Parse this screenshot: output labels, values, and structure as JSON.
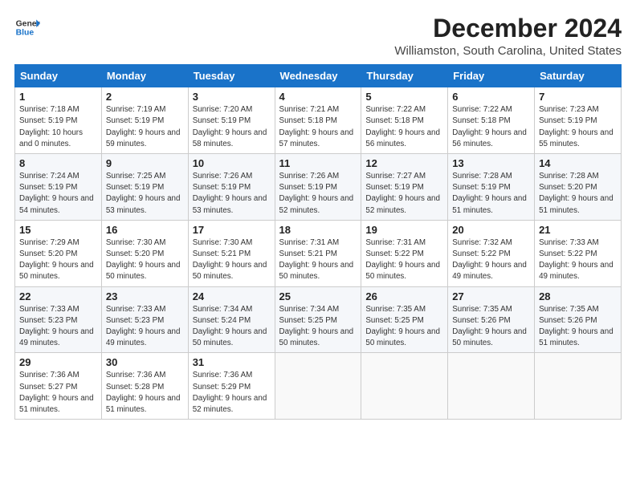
{
  "logo": {
    "line1": "General",
    "line2": "Blue"
  },
  "title": "December 2024",
  "location": "Williamston, South Carolina, United States",
  "weekdays": [
    "Sunday",
    "Monday",
    "Tuesday",
    "Wednesday",
    "Thursday",
    "Friday",
    "Saturday"
  ],
  "weeks": [
    [
      {
        "day": "1",
        "sunrise": "7:18 AM",
        "sunset": "5:19 PM",
        "daylight": "10 hours and 0 minutes."
      },
      {
        "day": "2",
        "sunrise": "7:19 AM",
        "sunset": "5:19 PM",
        "daylight": "9 hours and 59 minutes."
      },
      {
        "day": "3",
        "sunrise": "7:20 AM",
        "sunset": "5:19 PM",
        "daylight": "9 hours and 58 minutes."
      },
      {
        "day": "4",
        "sunrise": "7:21 AM",
        "sunset": "5:18 PM",
        "daylight": "9 hours and 57 minutes."
      },
      {
        "day": "5",
        "sunrise": "7:22 AM",
        "sunset": "5:18 PM",
        "daylight": "9 hours and 56 minutes."
      },
      {
        "day": "6",
        "sunrise": "7:22 AM",
        "sunset": "5:18 PM",
        "daylight": "9 hours and 56 minutes."
      },
      {
        "day": "7",
        "sunrise": "7:23 AM",
        "sunset": "5:19 PM",
        "daylight": "9 hours and 55 minutes."
      }
    ],
    [
      {
        "day": "8",
        "sunrise": "7:24 AM",
        "sunset": "5:19 PM",
        "daylight": "9 hours and 54 minutes."
      },
      {
        "day": "9",
        "sunrise": "7:25 AM",
        "sunset": "5:19 PM",
        "daylight": "9 hours and 53 minutes."
      },
      {
        "day": "10",
        "sunrise": "7:26 AM",
        "sunset": "5:19 PM",
        "daylight": "9 hours and 53 minutes."
      },
      {
        "day": "11",
        "sunrise": "7:26 AM",
        "sunset": "5:19 PM",
        "daylight": "9 hours and 52 minutes."
      },
      {
        "day": "12",
        "sunrise": "7:27 AM",
        "sunset": "5:19 PM",
        "daylight": "9 hours and 52 minutes."
      },
      {
        "day": "13",
        "sunrise": "7:28 AM",
        "sunset": "5:19 PM",
        "daylight": "9 hours and 51 minutes."
      },
      {
        "day": "14",
        "sunrise": "7:28 AM",
        "sunset": "5:20 PM",
        "daylight": "9 hours and 51 minutes."
      }
    ],
    [
      {
        "day": "15",
        "sunrise": "7:29 AM",
        "sunset": "5:20 PM",
        "daylight": "9 hours and 50 minutes."
      },
      {
        "day": "16",
        "sunrise": "7:30 AM",
        "sunset": "5:20 PM",
        "daylight": "9 hours and 50 minutes."
      },
      {
        "day": "17",
        "sunrise": "7:30 AM",
        "sunset": "5:21 PM",
        "daylight": "9 hours and 50 minutes."
      },
      {
        "day": "18",
        "sunrise": "7:31 AM",
        "sunset": "5:21 PM",
        "daylight": "9 hours and 50 minutes."
      },
      {
        "day": "19",
        "sunrise": "7:31 AM",
        "sunset": "5:22 PM",
        "daylight": "9 hours and 50 minutes."
      },
      {
        "day": "20",
        "sunrise": "7:32 AM",
        "sunset": "5:22 PM",
        "daylight": "9 hours and 49 minutes."
      },
      {
        "day": "21",
        "sunrise": "7:33 AM",
        "sunset": "5:22 PM",
        "daylight": "9 hours and 49 minutes."
      }
    ],
    [
      {
        "day": "22",
        "sunrise": "7:33 AM",
        "sunset": "5:23 PM",
        "daylight": "9 hours and 49 minutes."
      },
      {
        "day": "23",
        "sunrise": "7:33 AM",
        "sunset": "5:23 PM",
        "daylight": "9 hours and 49 minutes."
      },
      {
        "day": "24",
        "sunrise": "7:34 AM",
        "sunset": "5:24 PM",
        "daylight": "9 hours and 50 minutes."
      },
      {
        "day": "25",
        "sunrise": "7:34 AM",
        "sunset": "5:25 PM",
        "daylight": "9 hours and 50 minutes."
      },
      {
        "day": "26",
        "sunrise": "7:35 AM",
        "sunset": "5:25 PM",
        "daylight": "9 hours and 50 minutes."
      },
      {
        "day": "27",
        "sunrise": "7:35 AM",
        "sunset": "5:26 PM",
        "daylight": "9 hours and 50 minutes."
      },
      {
        "day": "28",
        "sunrise": "7:35 AM",
        "sunset": "5:26 PM",
        "daylight": "9 hours and 51 minutes."
      }
    ],
    [
      {
        "day": "29",
        "sunrise": "7:36 AM",
        "sunset": "5:27 PM",
        "daylight": "9 hours and 51 minutes."
      },
      {
        "day": "30",
        "sunrise": "7:36 AM",
        "sunset": "5:28 PM",
        "daylight": "9 hours and 51 minutes."
      },
      {
        "day": "31",
        "sunrise": "7:36 AM",
        "sunset": "5:29 PM",
        "daylight": "9 hours and 52 minutes."
      },
      null,
      null,
      null,
      null
    ]
  ]
}
